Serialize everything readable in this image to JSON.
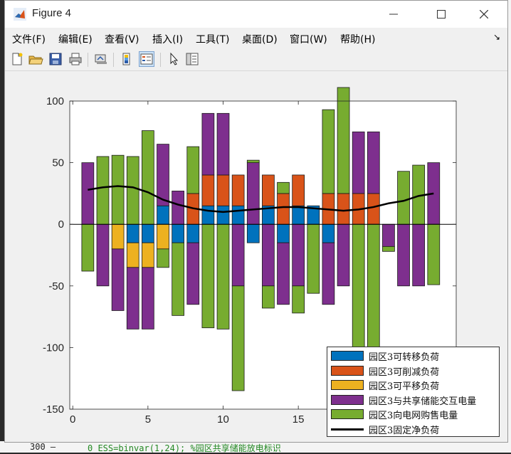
{
  "window": {
    "title": "Figure 4"
  },
  "menu": [
    "文件(F)",
    "编辑(E)",
    "查看(V)",
    "插入(I)",
    "工具(T)",
    "桌面(D)",
    "窗口(W)",
    "帮助(H)"
  ],
  "menu_arrow": "↘",
  "toolbar_icons": [
    "new-figure-icon",
    "open-file-icon",
    "save-icon",
    "print-icon",
    "link-icon",
    "colorbar-icon",
    "legend-icon",
    "pointer-icon",
    "property-editor-icon"
  ],
  "background_code": {
    "line": "300 —",
    "code": "0 ESS=binvar(1,24); %园区共享储能放电标识"
  },
  "colors": {
    "blue": "#0072bd",
    "orange": "#d95319",
    "yellow": "#edb120",
    "purple": "#7e2f8e",
    "green": "#77ac30",
    "line": "#000000"
  },
  "chart_data": {
    "type": "bar",
    "stacked": true,
    "xlim": [
      -0.2,
      25.5
    ],
    "ylim": [
      -150,
      100
    ],
    "xticks": [
      0,
      5,
      10,
      15
    ],
    "xtick_labels": [
      "0",
      "5",
      "10",
      "15"
    ],
    "yticks": [
      100,
      50,
      0,
      -50,
      -100,
      -150
    ],
    "ytick_labels": [
      "100",
      "50",
      "0",
      "-50",
      "-100",
      "-150"
    ],
    "x": [
      1,
      2,
      3,
      4,
      5,
      6,
      7,
      8,
      9,
      10,
      11,
      12,
      13,
      14,
      15,
      16,
      17,
      18,
      19,
      20,
      21,
      22,
      23,
      24
    ],
    "series": [
      {
        "name": "园区3可转移负荷",
        "color": "#0072bd",
        "values": [
          0,
          0,
          0,
          -15,
          -15,
          15,
          -15,
          -15,
          15,
          15,
          15,
          -15,
          15,
          -15,
          15,
          15,
          -15,
          0,
          0,
          0,
          0,
          0,
          0,
          0
        ]
      },
      {
        "name": "园区3可削减负荷",
        "color": "#d95319",
        "values": [
          0,
          0,
          0,
          0,
          0,
          0,
          0,
          25,
          25,
          25,
          25,
          0,
          25,
          25,
          25,
          0,
          25,
          25,
          25,
          25,
          0,
          0,
          0,
          0
        ]
      },
      {
        "name": "园区3可平移负荷",
        "color": "#edb120",
        "values": [
          0,
          0,
          -20,
          -20,
          -20,
          -20,
          0,
          0,
          0,
          0,
          0,
          0,
          0,
          0,
          0,
          0,
          0,
          0,
          0,
          0,
          0,
          0,
          0,
          0
        ]
      },
      {
        "name": "园区3与共享储能交互电量",
        "color": "#7e2f8e",
        "values": [
          50,
          -50,
          -50,
          -50,
          -50,
          50,
          27,
          -50,
          50,
          50,
          -50,
          50,
          -50,
          -50,
          -50,
          0,
          -50,
          -50,
          50,
          50,
          -18,
          -50,
          -50,
          50
        ]
      },
      {
        "name": "园区3向电网购售电量",
        "color": "#77ac30",
        "values": [
          -38,
          55,
          56,
          55,
          76,
          -15,
          -59,
          38,
          -84,
          -85,
          -85,
          2,
          -18,
          9,
          -22,
          -56,
          68,
          86,
          -102,
          -125,
          -4,
          43,
          48,
          -49
        ]
      }
    ],
    "line_series": {
      "name": "园区3固定净负荷",
      "color": "#000000",
      "x": [
        1,
        2,
        3,
        4,
        5,
        6,
        7,
        8,
        9,
        10,
        11,
        12,
        13,
        14,
        15,
        16,
        17,
        18,
        19,
        20,
        21,
        22,
        23,
        24
      ],
      "values": [
        28,
        30,
        31,
        30,
        26,
        20,
        16,
        13,
        11,
        10,
        11,
        12,
        13,
        14,
        14,
        13,
        12,
        11,
        12,
        14,
        17,
        19,
        23,
        25
      ]
    },
    "legend_position": "bottom-right",
    "grid": false
  }
}
